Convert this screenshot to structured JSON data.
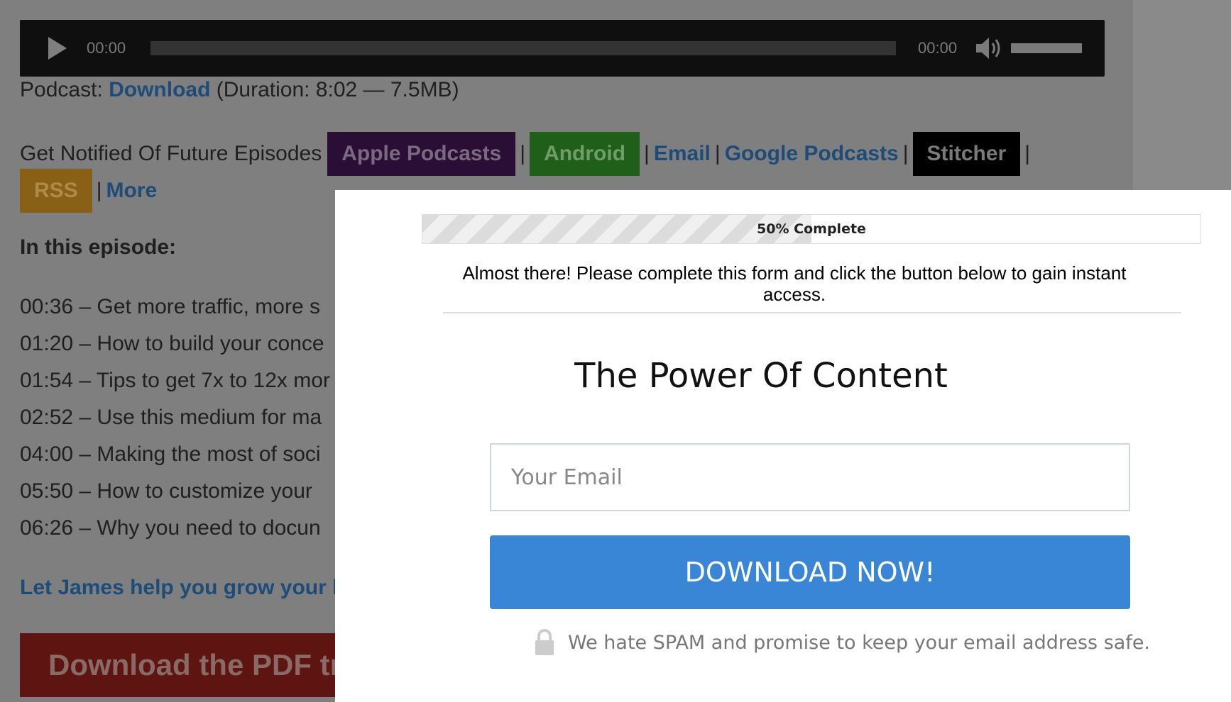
{
  "player": {
    "current_time": "00:00",
    "duration_time": "00:00"
  },
  "podcast": {
    "prefix": "Podcast:",
    "download_label": "Download",
    "meta": "(Duration: 8:02 — 7.5MB)"
  },
  "notify": {
    "label": "Get Notified Of Future Episodes",
    "apple": "Apple Podcasts",
    "android": "Android",
    "email": "Email",
    "google": "Google Podcasts",
    "stitcher": "Stitcher",
    "rss": "RSS",
    "more": "More",
    "separator": "|"
  },
  "episode": {
    "heading": "In this episode:",
    "items": [
      "00:36 – Get more traffic, more s",
      "01:20 – How to build your conce",
      "01:54 – Tips to get 7x to 12x mor",
      "02:52 – Use this medium for ma",
      "04:00 – Making the most of soci",
      "05:50 – How to customize your",
      "06:26 – Why you need to docun"
    ]
  },
  "help_link": "Let James help you grow your b",
  "pdf_button": "Download the PDF tr",
  "modal": {
    "progress_percent": 50,
    "progress_label": "50% Complete",
    "instructions": "Almost there! Please complete this form and click the button below to gain instant access.",
    "title": "The Power Of Content",
    "email_placeholder": "Your Email",
    "download_button": "DOWNLOAD NOW!",
    "spam_note": "We hate SPAM and promise to keep your email address safe."
  },
  "colors": {
    "button_blue": "#3a86d6",
    "apple_tag": "#2a0e35",
    "android_tag": "#1f5f1a",
    "stitcher_tag": "#000000",
    "rss_tag": "#8a6016"
  }
}
